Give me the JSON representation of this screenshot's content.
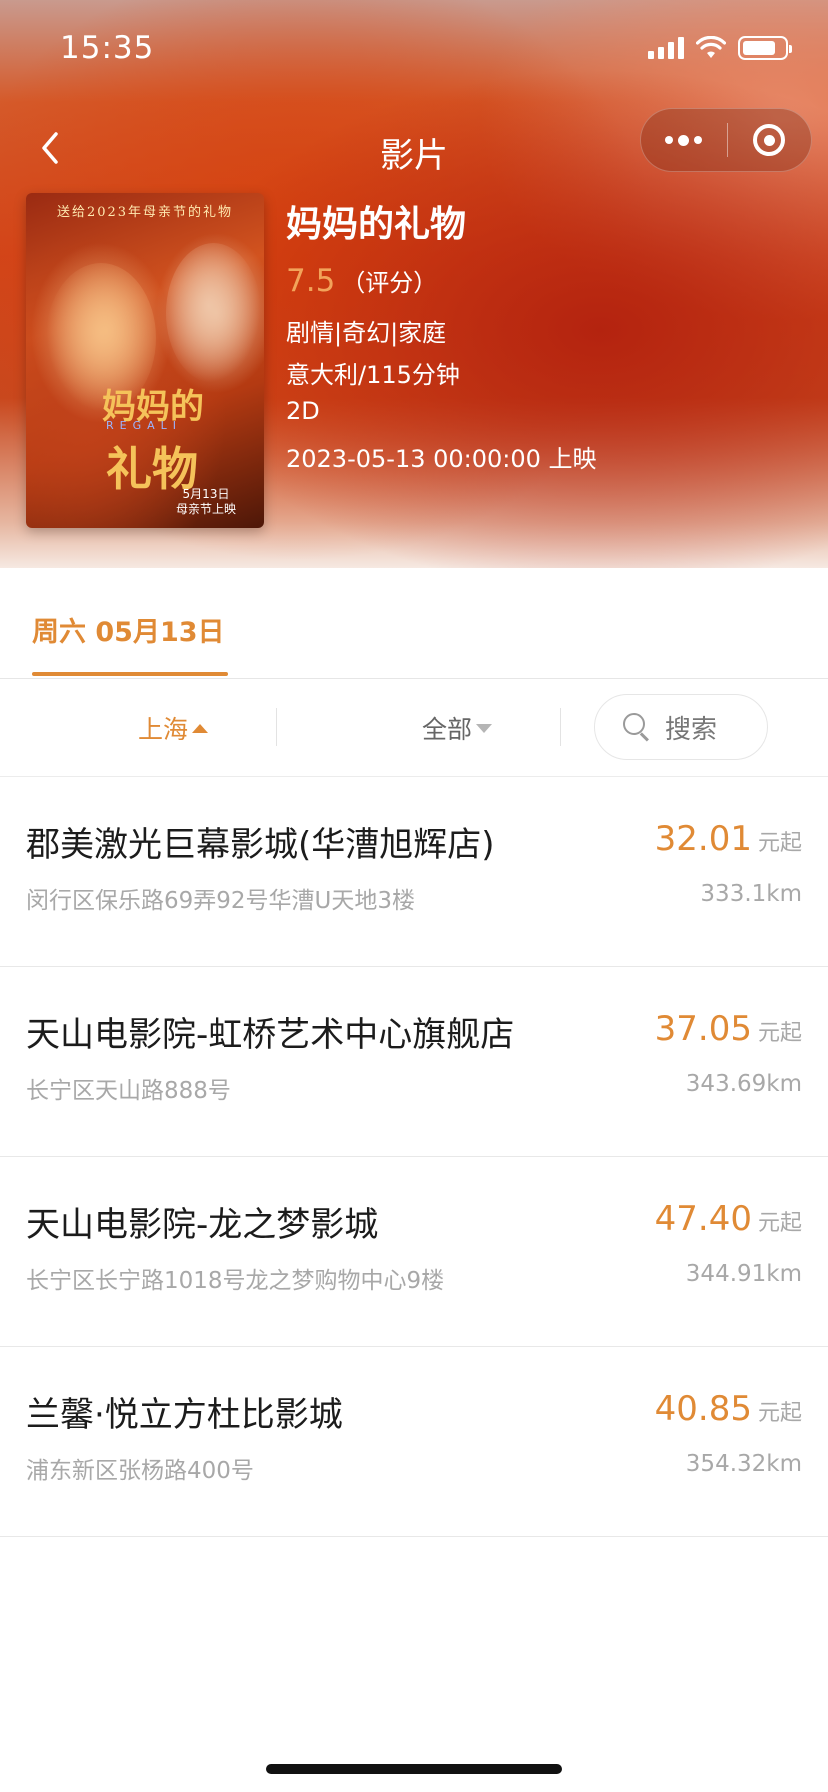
{
  "status_bar": {
    "time": "15:35"
  },
  "nav": {
    "title": "影片"
  },
  "movie": {
    "title": "妈妈的礼物",
    "score": "7.5",
    "score_label": "（评分）",
    "genres": "剧情|奇幻|家庭",
    "region_duration": "意大利/115分钟",
    "format": "2D",
    "release": "2023-05-13 00:00:00 上映"
  },
  "poster": {
    "tagline": "送给2023年母亲节的礼物",
    "title_line1": "妈妈的",
    "title_en": "REGALI",
    "title_line2": "礼物",
    "date_line1": "5月13日",
    "date_line2": "母亲节上映"
  },
  "date_tab": {
    "label": "周六 05月13日"
  },
  "filters": {
    "city": "上海",
    "area": "全部",
    "search_placeholder": "搜索"
  },
  "cinemas": [
    {
      "name": "郡美激光巨幕影城(华漕旭辉店)",
      "address": "闵行区保乐路69弄92号华漕U天地3楼",
      "price": "32.01",
      "unit": "元起",
      "distance": "333.1km"
    },
    {
      "name": "天山电影院-虹桥艺术中心旗舰店",
      "address": "长宁区天山路888号",
      "price": "37.05",
      "unit": "元起",
      "distance": "343.69km"
    },
    {
      "name": "天山电影院-龙之梦影城",
      "address": "长宁区长宁路1018号龙之梦购物中心9楼",
      "price": "47.40",
      "unit": "元起",
      "distance": "344.91km"
    },
    {
      "name": "兰馨·悦立方杜比影城",
      "address": "浦东新区张杨路400号",
      "price": "40.85",
      "unit": "元起",
      "distance": "354.32km"
    }
  ],
  "colors": {
    "accent": "#e08a35",
    "muted": "#a8a8a8"
  }
}
